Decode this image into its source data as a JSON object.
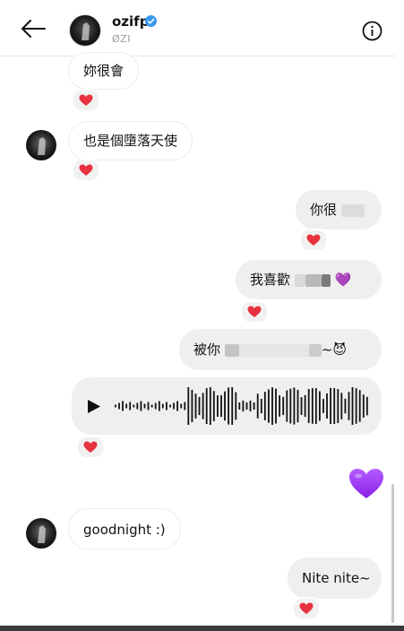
{
  "header": {
    "username": "ozifp",
    "subname": "ØZI",
    "icons": [
      "back-arrow-icon",
      "verified-badge-icon",
      "info-icon"
    ]
  },
  "messages": [
    {
      "side": "received",
      "text": "妳很會",
      "reaction": "heart"
    },
    {
      "side": "received",
      "text": "也是個墮落天使",
      "reaction": "heart"
    },
    {
      "side": "sent",
      "text": "你很",
      "reaction": "heart"
    },
    {
      "side": "sent",
      "text": "我喜歡",
      "emoji": "💜",
      "reaction": "heart"
    },
    {
      "side": "sent",
      "text": "被你",
      "suffix": "~",
      "emoji": "😈"
    },
    {
      "side": "received",
      "type": "voice",
      "reaction": "heart"
    },
    {
      "side": "sent",
      "emoji": "💜"
    },
    {
      "side": "received",
      "text": "goodnight :)"
    },
    {
      "side": "sent",
      "text": "Nite nite~",
      "reaction": "heart"
    }
  ],
  "colors": {
    "bubble": "#efefef",
    "heart": "#e8323f",
    "purple_heart": "#9b30ff",
    "verified": "#3897f0"
  }
}
